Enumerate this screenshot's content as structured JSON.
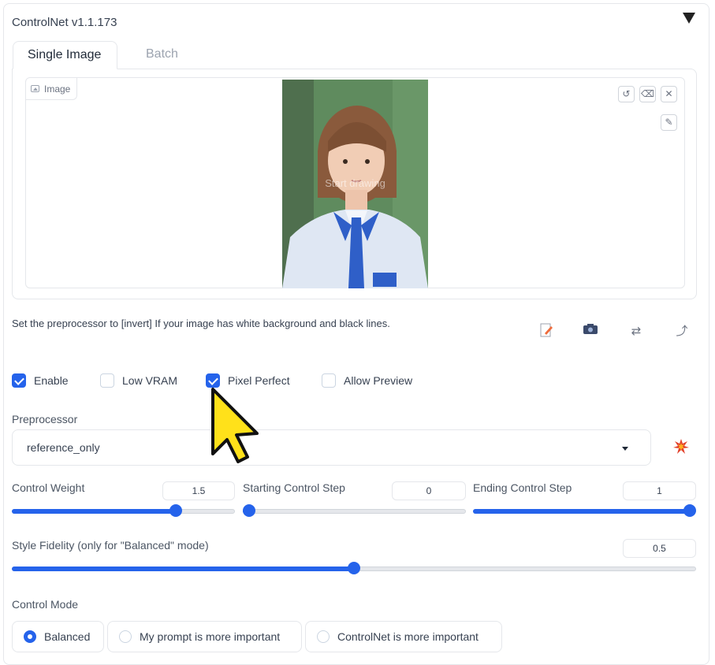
{
  "panel": {
    "title": "ControlNet v1.1.173"
  },
  "tabs": [
    {
      "label": "Single Image",
      "active": true
    },
    {
      "label": "Batch",
      "active": false
    }
  ],
  "image": {
    "label": "Image",
    "overlay_text": "Start drawing"
  },
  "hint": "Set the preprocessor to [invert] If your image has white background and black lines.",
  "checkboxes": [
    {
      "label": "Enable",
      "checked": true
    },
    {
      "label": "Low VRAM",
      "checked": false
    },
    {
      "label": "Pixel Perfect",
      "checked": true
    },
    {
      "label": "Allow Preview",
      "checked": false
    }
  ],
  "preprocessor": {
    "label": "Preprocessor",
    "value": "reference_only"
  },
  "sliders": {
    "control_weight": {
      "label": "Control Weight",
      "value": "1.5",
      "min": 0,
      "max": 2,
      "num": 1.5
    },
    "starting_step": {
      "label": "Starting Control Step",
      "value": "0",
      "min": 0,
      "max": 1,
      "num": 0
    },
    "ending_step": {
      "label": "Ending Control Step",
      "value": "1",
      "min": 0,
      "max": 1,
      "num": 1
    },
    "style_fidelity": {
      "label": "Style Fidelity (only for \"Balanced\" mode)",
      "value": "0.5",
      "min": 0,
      "max": 1,
      "num": 0.5
    }
  },
  "control_mode": {
    "label": "Control Mode",
    "options": [
      {
        "label": "Balanced",
        "selected": true
      },
      {
        "label": "My prompt is more important",
        "selected": false
      },
      {
        "label": "ControlNet is more important",
        "selected": false
      }
    ]
  },
  "icons": {
    "collapse": "triangle-down-icon",
    "image_label": "image-icon",
    "undo": "undo-icon",
    "erase": "eraser-icon",
    "clear": "close-icon",
    "brush": "brush-icon",
    "edit": "edit-document-icon",
    "camera": "camera-icon",
    "swap": "swap-icon",
    "send": "arrow-up-right-icon",
    "run": "explosion-icon",
    "pointer": "mouse-cursor-icon"
  },
  "colors": {
    "accent": "#2563eb",
    "cursor_fill": "#ffe11a"
  }
}
